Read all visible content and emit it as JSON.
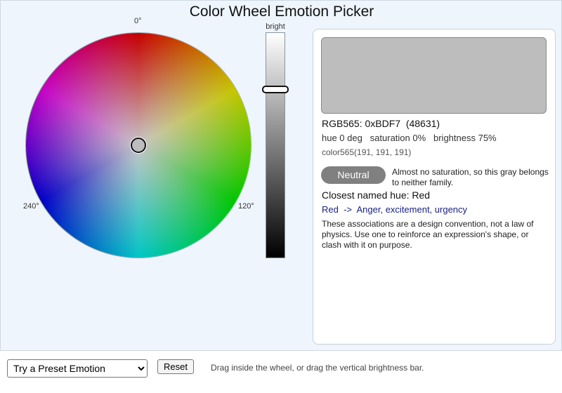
{
  "title": "Color Wheel Emotion Picker",
  "wheel": {
    "labels": {
      "top": "0°",
      "right": "120°",
      "left": "240°"
    },
    "selected_hue_deg": 0,
    "selected_saturation_pct": 0
  },
  "brightness": {
    "label": "bright",
    "value_pct": 75
  },
  "readout": {
    "swatch_color": "#BDBDBD",
    "rgb565": "RGB565: 0xBDF7  (48631)",
    "hsb": "hue 0 deg   saturation 0%   brightness 75%",
    "color565": "color565(191, 191, 191)",
    "family_badge": "Neutral",
    "family_note": "Almost no saturation, so this gray belongs to neither family.",
    "closest_hue": "Closest named hue: Red",
    "association": "Red  ->  Anger, excitement, urgency",
    "disclaimer": "These associations are a design convention, not a law of physics. Use one to reinforce an expression's shape, or clash with it on purpose."
  },
  "controls": {
    "preset_selected": "Try a Preset Emotion",
    "reset_label": "Reset",
    "hint": "Drag inside the wheel, or drag the vertical brightness bar."
  }
}
